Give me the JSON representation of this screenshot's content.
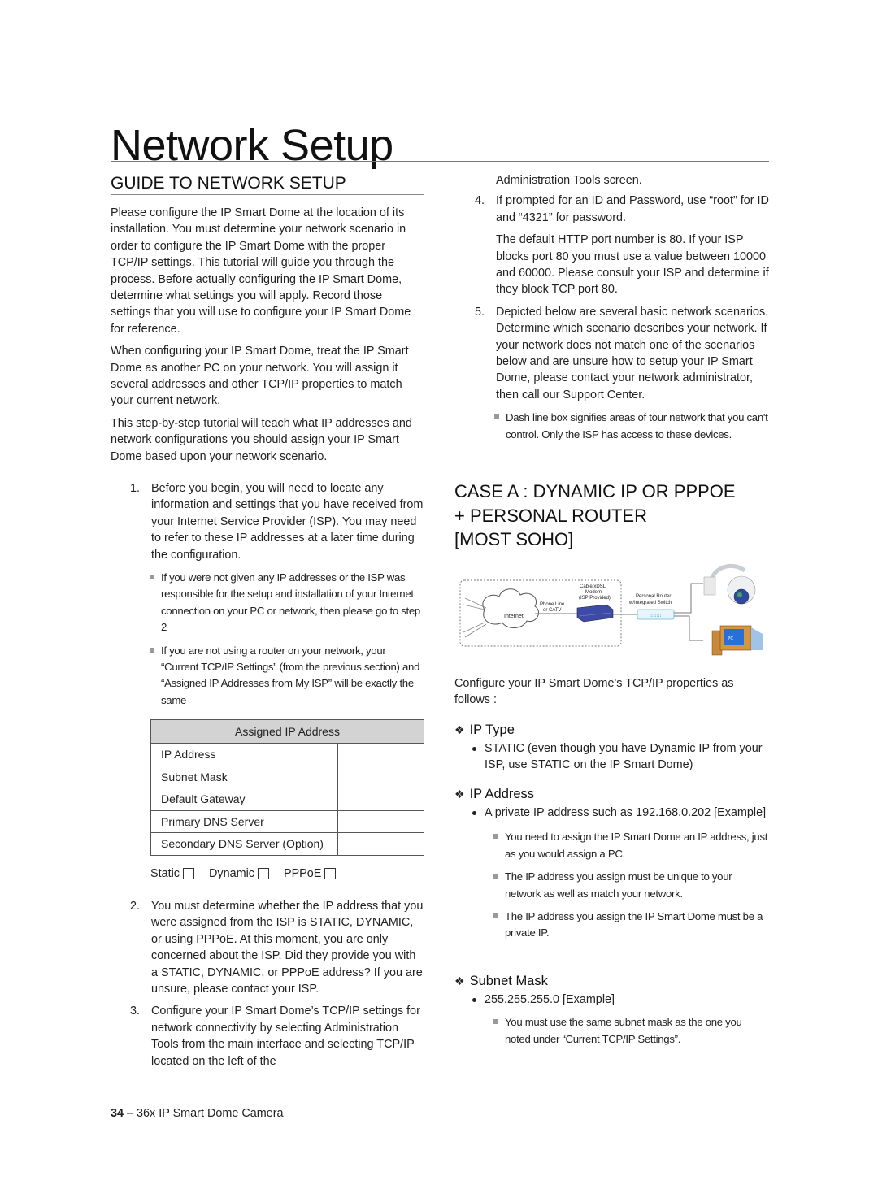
{
  "page": {
    "title": "Network Setup",
    "footer": {
      "page_number": "34",
      "separator": "–",
      "product": "36x IP Smart Dome Camera"
    }
  },
  "left": {
    "section_heading": "GUIDE TO NETWORK SETUP",
    "paragraphs": [
      "Please configure the IP Smart Dome at the location of its installation. You must determine your network scenario in order to configure the IP Smart Dome with the proper TCP/IP settings. This tutorial will guide you through the process. Before actually configuring the IP Smart Dome, determine what settings you will apply. Record those settings that you will use to configure your IP Smart Dome for reference.",
      "When configuring your IP Smart Dome, treat the IP Smart Dome as another PC on your network. You will assign it several addresses and other TCP/IP properties to match your current network.",
      "This step-by-step tutorial will teach what IP addresses and network configurations you should assign your IP Smart Dome based upon your network scenario."
    ],
    "steps": [
      {
        "num": "1.",
        "text": "Before you begin, you will need to locate any information and settings that you have received from your Internet Service Provider (ISP). You may need to refer to these IP addresses at a later time during the configuration.",
        "notes": [
          "If you were not given any IP addresses or the ISP was responsible for the setup and installation of your Internet connection on your PC or network, then please go to step  2",
          "If you are not using a router on your network, your “Current TCP/IP Settings” (from the previous section) and “Assigned IP Addresses from My ISP” will be exactly the same"
        ]
      },
      {
        "num": "2.",
        "text": "You must determine whether the IP address that you were assigned from the ISP is STATIC, DYNAMIC, or using PPPoE. At this moment, you are only concerned about the ISP. Did they provide you with a STATIC, DYNAMIC, or PPPoE address? If you are unsure, please contact your ISP."
      },
      {
        "num": "3.",
        "text": "Configure your IP Smart Dome’s TCP/IP settings for network connectivity by selecting Administration Tools from the main interface and selecting TCP/IP located on the left of the"
      }
    ],
    "table": {
      "header": "Assigned IP Address",
      "rows": [
        {
          "label": "IP Address",
          "value": ""
        },
        {
          "label": "Subnet Mask",
          "value": ""
        },
        {
          "label": "Default Gateway",
          "value": ""
        },
        {
          "label": "Primary DNS Server",
          "value": ""
        },
        {
          "label": "Secondary DNS Server (Option)",
          "value": ""
        }
      ]
    },
    "checkboxes": [
      {
        "label": "Static",
        "checked": false
      },
      {
        "label": "Dynamic",
        "checked": false
      },
      {
        "label": "PPPoE",
        "checked": false
      }
    ]
  },
  "right": {
    "continued_text": "Administration Tools screen.",
    "step4": {
      "num": "4.",
      "text": "If prompted for an ID and Password, use “root” for ID and “4321” for password.",
      "extra": "The default HTTP port number is 80. If your ISP blocks port 80 you must use a value between 10000 and 60000. Please consult your ISP and determine if they block TCP port 80."
    },
    "step5": {
      "num": "5.",
      "text": "Depicted below are several basic network scenarios. Determine which scenario describes your network. If your network does not match one of the scenarios below and are unsure how to setup your IP Smart Dome, please contact your network administrator, then call our Support Center.",
      "note": "Dash line box signifies areas of tour network that you can't control. Only the ISP has access to these devices."
    },
    "case_heading": [
      "CASE A : DYNAMIC IP OR PPPOE",
      "+ PERSONAL ROUTER",
      "[MOST SOHO]"
    ],
    "diagram": {
      "internet_label": "Internet",
      "phone_line_label": [
        "Phone Line",
        "or CATV"
      ],
      "modem_label": [
        "Cable/xDSL",
        "Modem",
        "(ISP Provided)"
      ],
      "router_label": [
        "Personal Router",
        "w/Integrated Switch"
      ],
      "pc_label": "PC"
    },
    "intro": "Configure your IP Smart Dome's TCP/IP properties as follows :",
    "sections": [
      {
        "heading": "IP Type",
        "bullets": [
          "STATIC (even though you have Dynamic IP from your ISP, use STATIC on the IP Smart Dome)"
        ],
        "notes": []
      },
      {
        "heading": "IP Address",
        "bullets": [
          "A private IP address such as 192.168.0.202 [Example]"
        ],
        "notes": [
          "You need to assign the IP Smart Dome an IP address, just as you would assign a PC.",
          "The IP address you assign must be unique to your network as well as match your network.",
          "The IP address you assign the IP Smart Dome must be a private IP."
        ]
      },
      {
        "heading": "Subnet Mask",
        "bullets": [
          "255.255.255.0 [Example]"
        ],
        "notes": [
          "You must use the same subnet mask as the one you noted under “Current TCP/IP Settings”."
        ]
      }
    ]
  }
}
